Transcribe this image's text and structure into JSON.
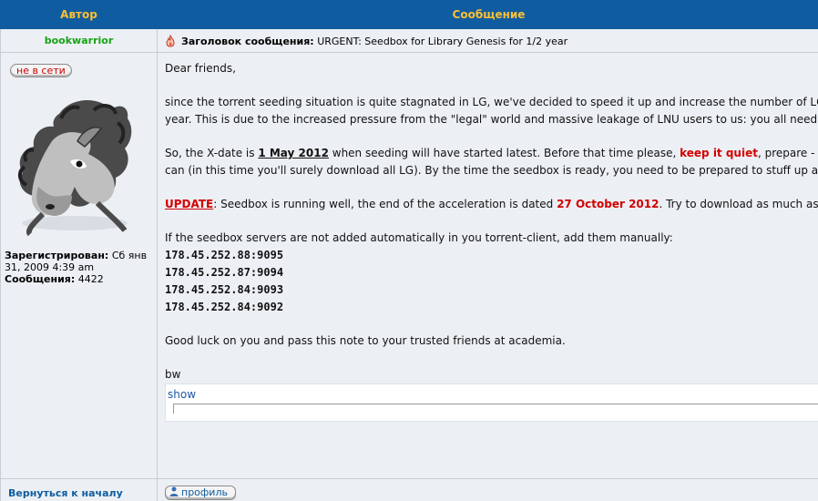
{
  "header": {
    "author_col": "Автор",
    "message_col": "Сообщение"
  },
  "post": {
    "author": "bookwarrior",
    "subject_label": "Заголовок сообщения:",
    "subject_text": "URGENT: Seedbox for Library Genesis for 1/2 year",
    "status": "не в сети",
    "registered_label": "Зарегистрирован:",
    "registered_value": "Сб янв 31, 2009 4:39 am",
    "posts_label": "Сообщения:",
    "posts_value": "4422"
  },
  "message": {
    "greeting": "Dear friends,",
    "p1_line1": "since the torrent seeding situation is quite stagnated in LG, we've decided to speed it up and increase the number of LG",
    "p1_line2": "year. This is due to the increased pressure from the \"legal\" world and massive leakage of LNU users to us: you all need b",
    "p2_a": "So, the X-date is ",
    "p2_date": "1 May 2012",
    "p2_b": " when seeding will have started latest. Before that time please, ",
    "p2_quiet": "keep it quiet",
    "p2_c": ", prepare - ",
    "p2_line2": "can (in this time you'll surely download all LG). By the time the seedbox is ready, you need to be prepared to stuff up a",
    "update_label": "UPDATE",
    "update_a": ": Seedbox is running well, the end of the acceleration is dated ",
    "update_date": "27 October 2012",
    "update_b": ". Try to download as much as y",
    "servers_intro": "If the seedbox servers are not added automatically in you torrent-client, add them manually:",
    "servers": [
      "178.45.252.88:9095",
      "178.45.252.87:9094",
      "178.45.252.84:9093",
      "178.45.252.84:9092"
    ],
    "closing": "Good luck on you and pass this note to your trusted friends at academia.",
    "signature": "bw",
    "spoiler_label": "show"
  },
  "footer": {
    "back_to_top": "Вернуться к началу",
    "profile_button": "профиль"
  },
  "colors": {
    "header_bg": "#0f5da0",
    "header_text": "#ffbf33",
    "author": "#16a316",
    "row_bg": "#ecf0f4",
    "accent_red": "#d40000"
  },
  "icons": {
    "subject": "flame-icon",
    "avatar": "horse-avatar",
    "profile": "user-icon"
  }
}
